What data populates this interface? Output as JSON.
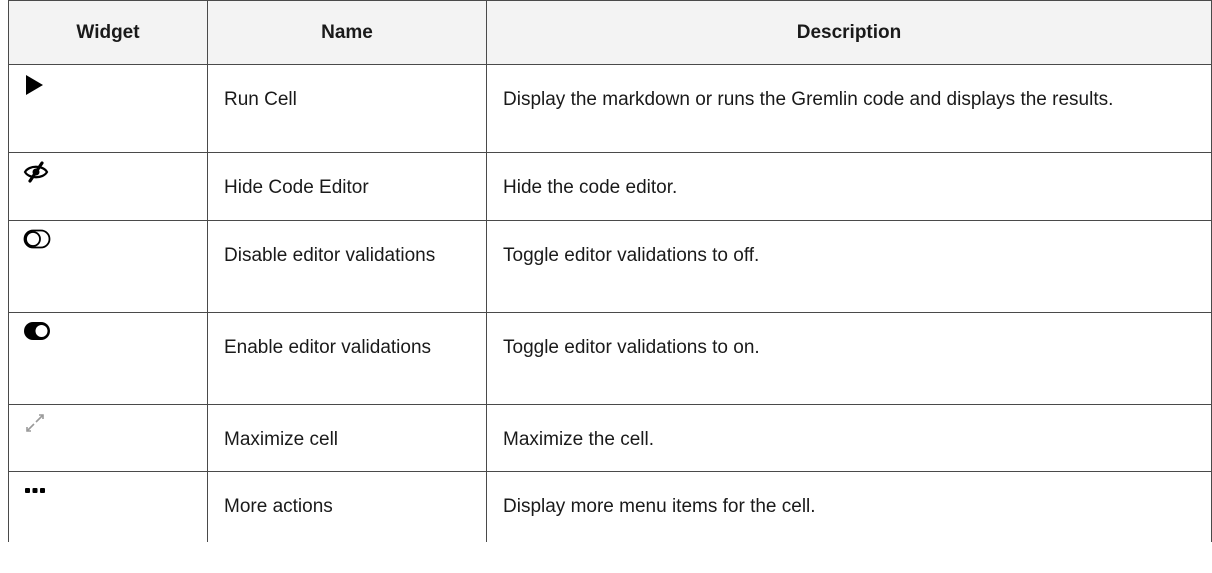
{
  "table": {
    "headers": {
      "widget": "Widget",
      "name": "Name",
      "description": "Description"
    },
    "rows": [
      {
        "icon": "play-icon",
        "name": "Run Cell",
        "description": "Display the markdown or runs the Gremlin code and displays the results."
      },
      {
        "icon": "eye-slash-icon",
        "name": "Hide Code Editor",
        "description": "Hide the code editor."
      },
      {
        "icon": "toggle-off-icon",
        "name": "Disable editor validations",
        "description": "Toggle editor validations to off."
      },
      {
        "icon": "toggle-on-icon",
        "name": "Enable editor validations",
        "description": "Toggle editor validations to on."
      },
      {
        "icon": "maximize-icon",
        "name": "Maximize cell",
        "description": "Maximize the cell."
      },
      {
        "icon": "ellipsis-icon",
        "name": "More actions",
        "description": "Display more menu items for the cell."
      }
    ]
  }
}
